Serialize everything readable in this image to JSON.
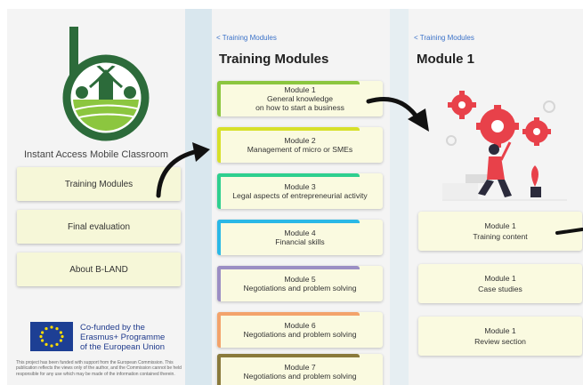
{
  "screen1": {
    "app_title": "Instant Access Mobile Classroom",
    "menu": [
      {
        "label": "Training Modules"
      },
      {
        "label": "Final evaluation"
      },
      {
        "label": "About B-LAND"
      }
    ],
    "eu_label": "Co-funded by the\nErasmus+ Programme\nof the European Union",
    "disclaimer": "This project has been funded with support from the European Commission. This publication reflects the views only of the author, and the Commission cannot be held responsible for any use which may be made of the information contained therein."
  },
  "screen2": {
    "back": "< Training Modules",
    "title": "Training Modules",
    "modules": [
      {
        "line1": "Module 1",
        "line2": "General knowledge",
        "line3": "on how to start a business",
        "color": "#8cc63f"
      },
      {
        "line1": "Module 2",
        "line2": "Management of micro or SMEs",
        "color": "#d7e02a"
      },
      {
        "line1": "Module 3",
        "line2": "Legal aspects of entrepreneurial activity",
        "color": "#2ecf8f"
      },
      {
        "line1": "Module 4",
        "line2": "Financial skills",
        "color": "#2ab8e6"
      },
      {
        "line1": "Module 5",
        "line2": "Negotiations and problem solving",
        "color": "#9b8ec4"
      },
      {
        "line1": "Module 6",
        "line2": "Negotiations and problem solving",
        "color": "#f3a36b"
      },
      {
        "line1": "Module 7",
        "line2": "Negotiations and problem solving",
        "color": "#8a7a3c"
      }
    ]
  },
  "screen3": {
    "back": "< Training Modules",
    "title": "Module 1",
    "sections": [
      {
        "line1": "Module 1",
        "line2": "Training content"
      },
      {
        "line1": "Module 1",
        "line2": "Case studies"
      },
      {
        "line1": "Module 1",
        "line2": "Review section"
      }
    ]
  },
  "colors": {
    "brand_green": "#6aa636",
    "card_bg": "#fafae0",
    "eu_blue": "#1d3f94",
    "accent_red": "#e8414a"
  }
}
